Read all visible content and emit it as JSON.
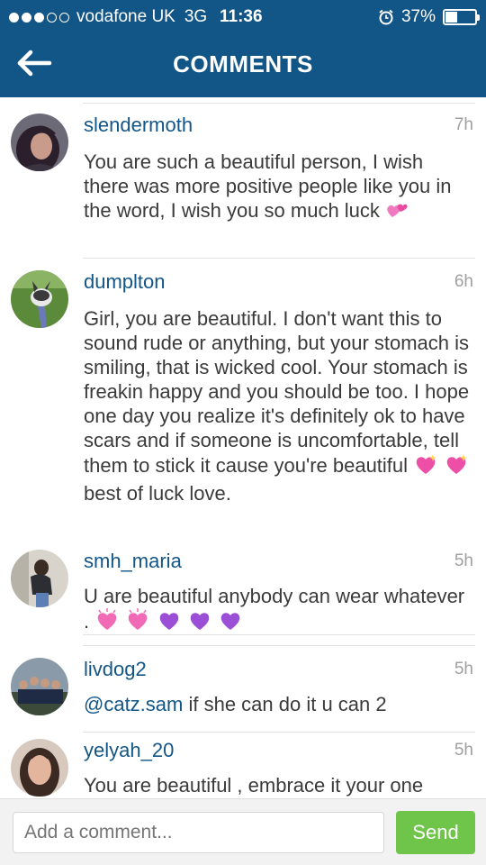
{
  "status_bar": {
    "signal_bars": 3,
    "signal_total": 5,
    "carrier": "vodafone UK",
    "network": "3G",
    "time": "11:36",
    "battery": "37%",
    "battery_level": 0.37
  },
  "header": {
    "title": "COMMENTS",
    "back_icon": "arrow-left-icon",
    "color": "#125688"
  },
  "comments": [
    {
      "username": "slendermoth",
      "time": "7h",
      "text": "You are such a beautiful person, I wish there was more positive people like you in the word, I wish you so much luck",
      "emojis": [
        "hearts-icon"
      ]
    },
    {
      "username": "dumplton",
      "time": "6h",
      "text": "Girl, you are beautiful. I don't want this to sound rude or anything, but your stomach is smiling, that is wicked cool. Your stomach is freakin happy and you should be too. I hope one day you realize it's definitely ok to have scars and if someone is uncomfortable, tell them to stick it cause you're beautiful",
      "emojis_before_tail": [
        "sparkling-heart-icon",
        "sparkling-heart-icon"
      ],
      "tail": "best of luck love."
    },
    {
      "username": "smh_maria",
      "time": "5h",
      "text": "U are beautiful anybody can wear whatever .",
      "emojis": [
        "sparkling-heart-icon",
        "sparkling-heart-icon",
        "purple-heart-icon",
        "purple-heart-icon",
        "purple-heart-icon"
      ]
    },
    {
      "username": "livdog2",
      "time": "5h",
      "mention": "@catz.sam",
      "text": "if she can do it u can 2"
    },
    {
      "username": "yelyah_20",
      "time": "5h",
      "text": "You are beautiful , embrace it your one"
    }
  ],
  "composer": {
    "placeholder": "Add a comment...",
    "send_label": "Send",
    "send_color": "#6fc44a"
  }
}
